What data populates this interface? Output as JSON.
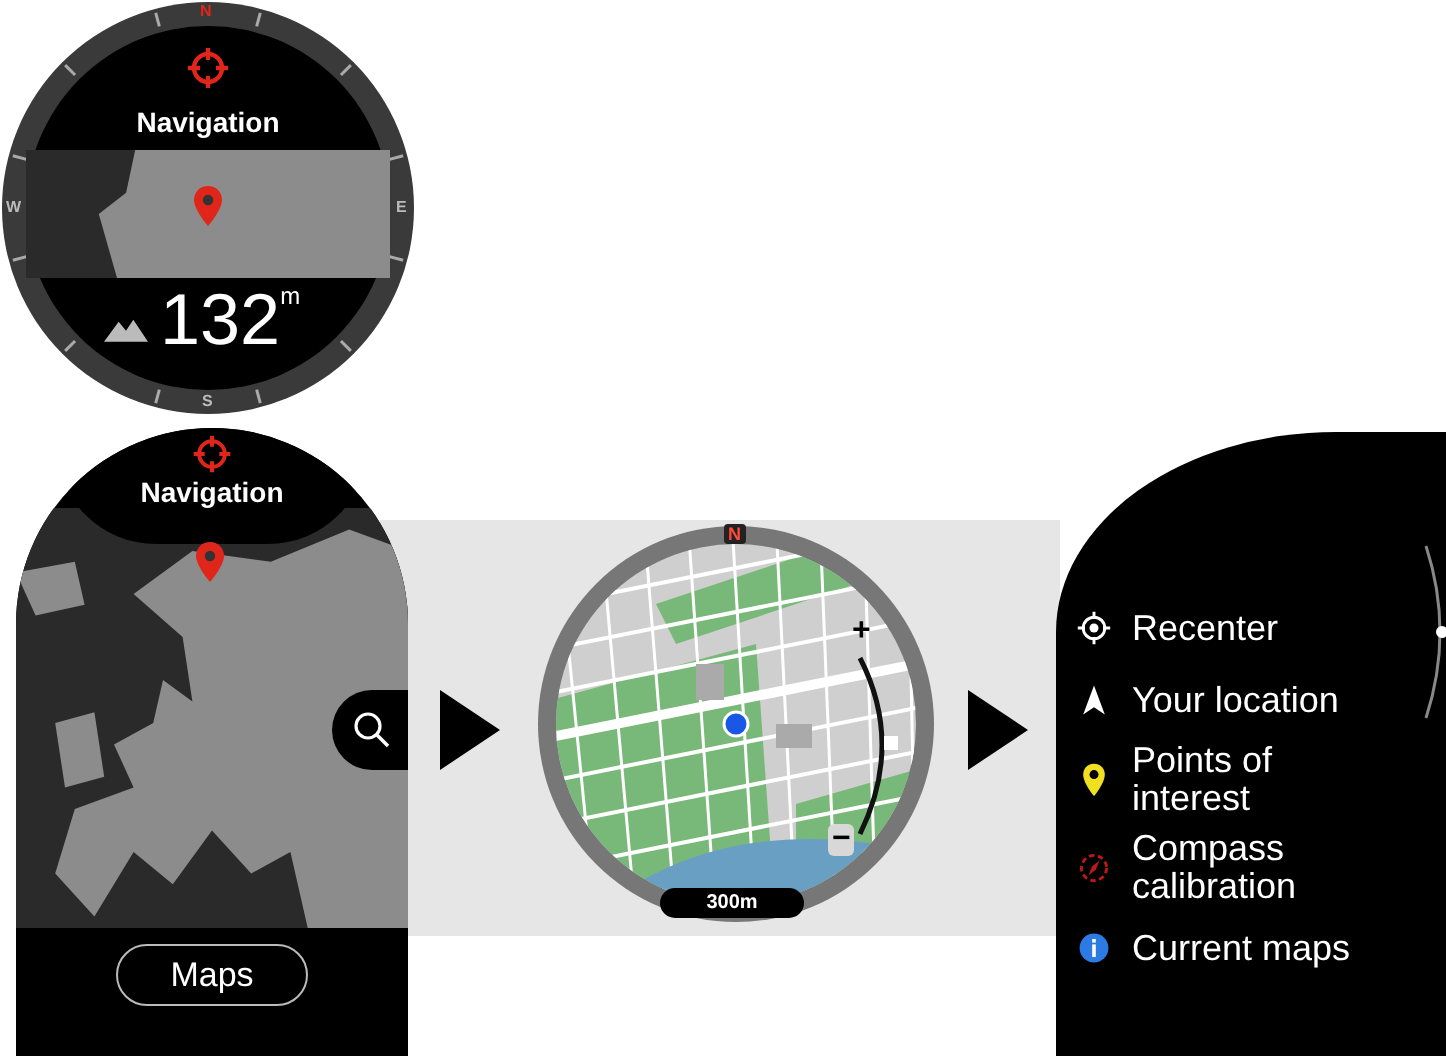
{
  "watch_face": {
    "title": "Navigation",
    "bezel_letters": [
      "N",
      "E",
      "S",
      "W"
    ],
    "altitude": "132$^{m}$"
  },
  "map_overview": {
    "title": "Navigation",
    "button": "Maps"
  },
  "map_view": {
    "north": "N",
    "zoom_in": "+",
    "zoom_out": "−",
    "scale": "300m"
  },
  "menu": {
    "items": [
      {
        "kind": "recenter",
        "label": "Recenter"
      },
      {
        "kind": "location",
        "label": "Your location"
      },
      {
        "kind": "poi",
        "label": "Points of interest"
      },
      {
        "kind": "compass",
        "label": "Compass calibration"
      },
      {
        "kind": "info",
        "label": "Current maps"
      }
    ]
  }
}
